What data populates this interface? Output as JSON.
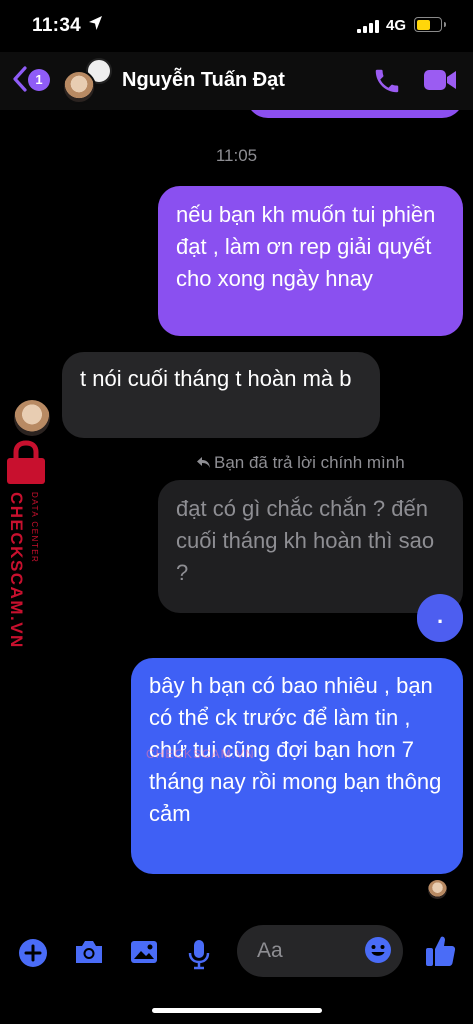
{
  "status_bar": {
    "time": "11:34",
    "network": "4G"
  },
  "header": {
    "unread_count": "1",
    "contact_name": "Nguyễn Tuấn Đạt"
  },
  "chat": {
    "timestamp": "11:05",
    "messages": [
      {
        "sender": "me",
        "text": "nếu bạn kh muốn tui phiền đạt , làm ơn rep giải quyết cho xong ngày hnay"
      },
      {
        "sender": "them",
        "text": "t nói cuối tháng t hoàn mà b"
      },
      {
        "sender": "them",
        "reply_label": "Bạn đã trả lời chính mình",
        "text": "đạt có gì chắc chắn ? đến cuối tháng kh hoàn thì sao ?"
      },
      {
        "sender": "me",
        "text": "."
      },
      {
        "sender": "me",
        "text": "bây h bạn có bao nhiêu , bạn có thể ck trước để làm tin , chứ tui cũng đợi bạn hơn 7 tháng nay rồi mong bạn thông cảm"
      }
    ]
  },
  "watermark": {
    "brand": "CHECKSCAM.VN",
    "sub": "DATA CENTER",
    "center": "CHECKSCAM.VN"
  },
  "composer": {
    "placeholder": "Aa"
  },
  "colors": {
    "accent": "#8a50f0",
    "blue": "#3f60f5",
    "watermark": "#c8102e"
  }
}
